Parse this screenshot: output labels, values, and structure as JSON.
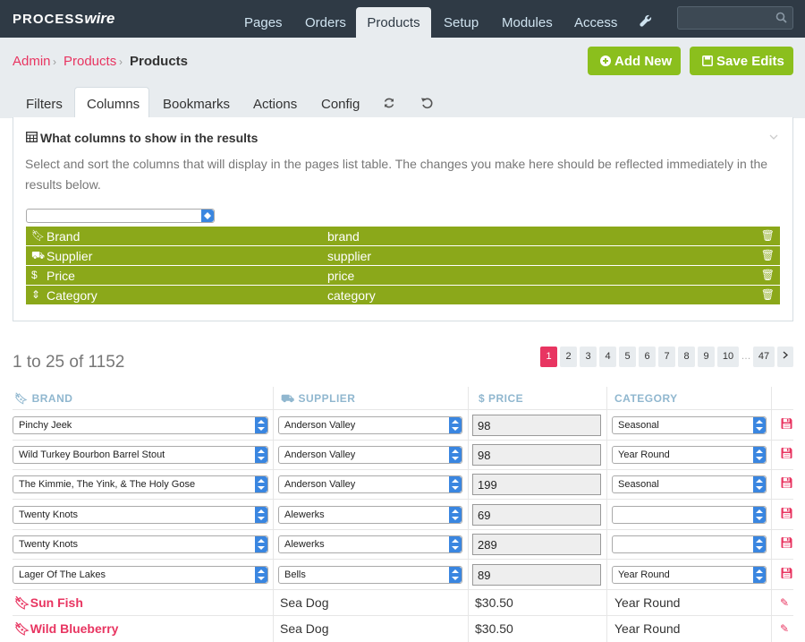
{
  "app": {
    "logo_a": "PROCESS",
    "logo_b": "wire"
  },
  "nav": {
    "items": [
      {
        "label": "Pages"
      },
      {
        "label": "Orders"
      },
      {
        "label": "Products"
      },
      {
        "label": "Setup"
      },
      {
        "label": "Modules"
      },
      {
        "label": "Access"
      }
    ],
    "active": "Products",
    "wrench_icon": "wrench-icon",
    "search_icon": "search-icon"
  },
  "breadcrumb": {
    "a": "Admin",
    "b": "Products",
    "current": "Products"
  },
  "buttons": {
    "add_new": "Add New",
    "save_edits": "Save Edits"
  },
  "tabs": {
    "filters": "Filters",
    "columns": "Columns",
    "bookmarks": "Bookmarks",
    "actions": "Actions",
    "config": "Config"
  },
  "panel": {
    "title": "What columns to show in the results",
    "desc": "Select and sort the columns that will display in the pages list table. The changes you make here should be reflected immediately in the results below.",
    "columns": [
      {
        "icon": "bookmark-icon",
        "label": "Brand",
        "name": "brand"
      },
      {
        "icon": "truck-icon",
        "label": "Supplier",
        "name": "supplier"
      },
      {
        "icon": "dollar-icon",
        "label": "Price",
        "name": "price"
      },
      {
        "icon": "sort-icon",
        "label": "Category",
        "name": "category"
      }
    ]
  },
  "results": {
    "count": "1 to 25 of 1152",
    "pages": [
      "1",
      "2",
      "3",
      "4",
      "5",
      "6",
      "7",
      "8",
      "9",
      "10",
      "47"
    ],
    "ellipsis": "…",
    "headers": {
      "brand": "BRAND",
      "supplier": "SUPPLIER",
      "price": "PRICE",
      "category": "CATEGORY"
    },
    "edit_rows": [
      {
        "brand": "Pinchy Jeek",
        "supplier": "Anderson Valley",
        "price": "98",
        "category": "Seasonal"
      },
      {
        "brand": "Wild Turkey Bourbon Barrel Stout",
        "supplier": "Anderson Valley",
        "price": "98",
        "category": "Year Round"
      },
      {
        "brand": "The Kimmie, The Yink, & The Holy Gose",
        "supplier": "Anderson Valley",
        "price": "199",
        "category": "Seasonal"
      },
      {
        "brand": "Twenty Knots",
        "supplier": "Alewerks",
        "price": "69",
        "category": ""
      },
      {
        "brand": "Twenty Knots",
        "supplier": "Alewerks",
        "price": "289",
        "category": ""
      },
      {
        "brand": "Lager Of The Lakes",
        "supplier": "Bells",
        "price": "89",
        "category": "Year Round"
      }
    ],
    "view_rows": [
      {
        "brand": "Sun Fish",
        "supplier": "Sea Dog",
        "price": "$30.50",
        "category": "Year Round"
      },
      {
        "brand": "Wild Blueberry",
        "supplier": "Sea Dog",
        "price": "$30.50",
        "category": "Year Round"
      }
    ]
  }
}
